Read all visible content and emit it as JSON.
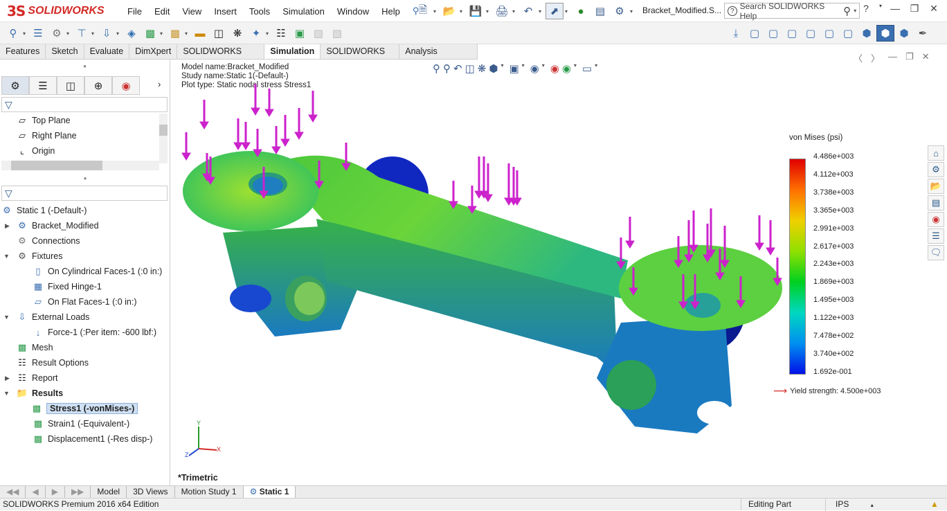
{
  "app": {
    "brand_prefix": "3S",
    "brand_name": "SOLIDWORKS",
    "doc_title": "Bracket_Modified.S..."
  },
  "menu": [
    "File",
    "Edit",
    "View",
    "Insert",
    "Tools",
    "Simulation",
    "Window",
    "Help"
  ],
  "help_search": {
    "placeholder": "Search SOLIDWORKS Help"
  },
  "ribbon_tabs": [
    {
      "label": "Features",
      "active": false
    },
    {
      "label": "Sketch",
      "active": false
    },
    {
      "label": "Evaluate",
      "active": false
    },
    {
      "label": "DimXpert",
      "active": false
    },
    {
      "label": "SOLIDWORKS Add-Ins",
      "active": false
    },
    {
      "label": "Simulation",
      "active": true
    },
    {
      "label": "SOLIDWORKS MBD",
      "active": false
    },
    {
      "label": "Analysis Preparation",
      "active": false
    }
  ],
  "feature_tree_top": [
    "Top Plane",
    "Right Plane",
    "Origin"
  ],
  "tree": {
    "study": "Static 1 (-Default-)",
    "part": "Bracket_Modified",
    "connections": "Connections",
    "fixtures": "Fixtures",
    "fixture_items": [
      "On Cylindrical Faces-1 (:0 in:)",
      "Fixed Hinge-1",
      "On Flat Faces-1 (:0 in:)"
    ],
    "external_loads": "External Loads",
    "force": "Force-1 (:Per item: -600 lbf:)",
    "mesh": "Mesh",
    "result_options": "Result Options",
    "report": "Report",
    "results": "Results",
    "result_items": [
      "Stress1 (-vonMises-)",
      "Strain1 (-Equivalent-)",
      "Displacement1 (-Res disp-)"
    ]
  },
  "viewport": {
    "model_name": "Model name:Bracket_Modified",
    "study_name": "Study name:Static 1(-Default-)",
    "plot_type": "Plot type: Static nodal stress Stress1",
    "view_label": "*Trimetric",
    "axis_x": "X",
    "axis_y": "Y",
    "axis_z": "Z"
  },
  "legend": {
    "title": "von Mises (psi)",
    "ticks": [
      "4.486e+003",
      "4.112e+003",
      "3.738e+003",
      "3.365e+003",
      "2.991e+003",
      "2.617e+003",
      "2.243e+003",
      "1.869e+003",
      "1.495e+003",
      "1.122e+003",
      "7.478e+002",
      "3.740e+002",
      "1.692e-001"
    ],
    "yield": "Yield strength: 4.500e+003"
  },
  "bottom_tabs": [
    "Model",
    "3D Views",
    "Motion Study 1",
    "Static 1"
  ],
  "status": {
    "left": "SOLIDWORKS Premium 2016 x64 Edition",
    "mode": "Editing Part",
    "units": "IPS"
  },
  "colors": {
    "load_arrow": "#cc22cc",
    "accent_red": "#d42a26",
    "selection": "#cfe0f3"
  }
}
